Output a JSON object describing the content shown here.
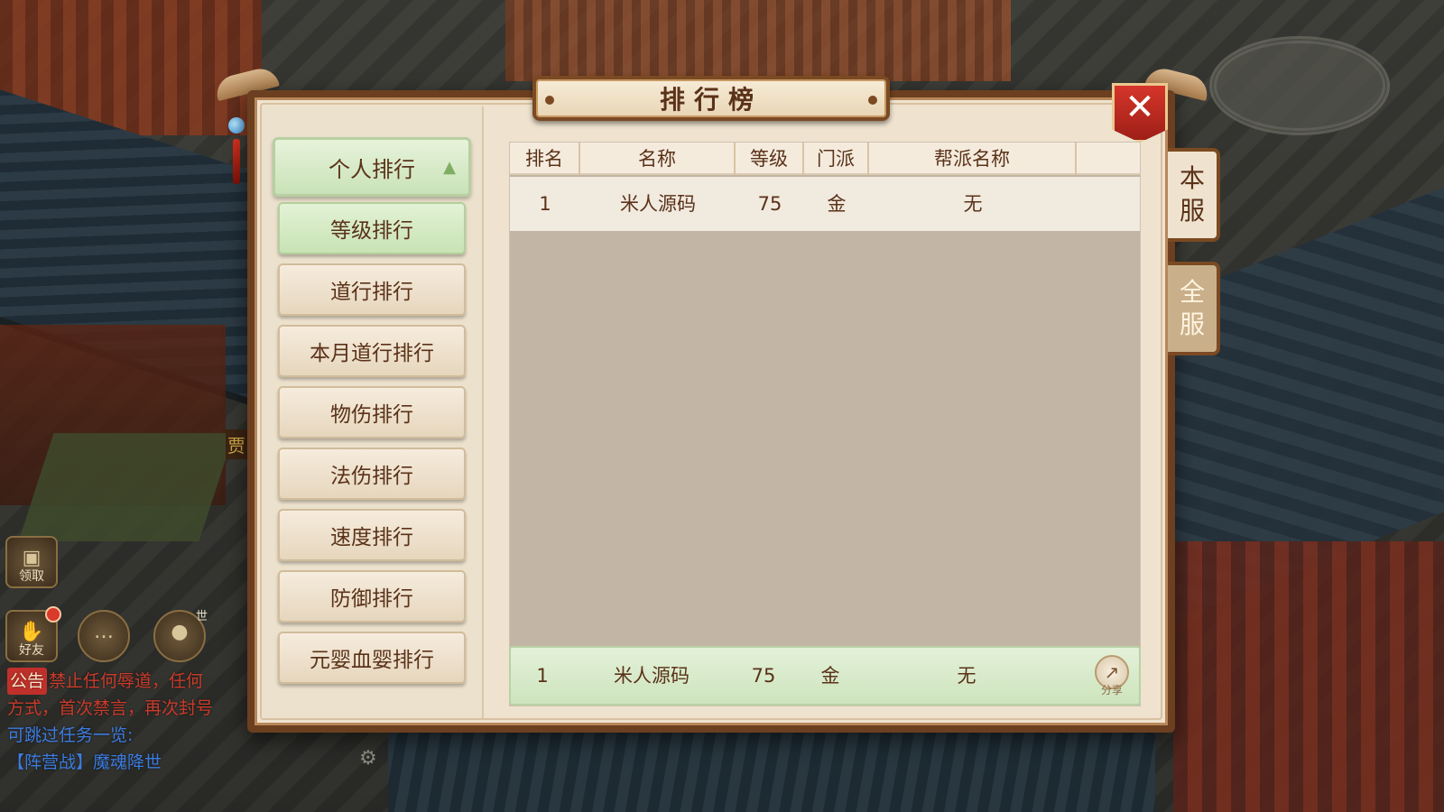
{
  "dialog": {
    "title": "排行榜",
    "close_label": "✕"
  },
  "server_tabs": [
    {
      "label_1": "本",
      "label_2": "服",
      "active": true
    },
    {
      "label_1": "全",
      "label_2": "服",
      "active": false
    }
  ],
  "category": {
    "header": "个人排行",
    "items": [
      {
        "label": "等级排行",
        "selected": true
      },
      {
        "label": "道行排行",
        "selected": false
      },
      {
        "label": "本月道行排行",
        "selected": false
      },
      {
        "label": "物伤排行",
        "selected": false
      },
      {
        "label": "法伤排行",
        "selected": false
      },
      {
        "label": "速度排行",
        "selected": false
      },
      {
        "label": "防御排行",
        "selected": false
      },
      {
        "label": "元婴血婴排行",
        "selected": false
      }
    ]
  },
  "table": {
    "columns": [
      "排名",
      "名称",
      "等级",
      "门派",
      "帮派名称"
    ],
    "rows": [
      {
        "rank": "1",
        "name": "米人源码",
        "level": "75",
        "school": "金",
        "guild": "无"
      }
    ]
  },
  "my_rank": {
    "rank": "1",
    "name": "米人源码",
    "level": "75",
    "school": "金",
    "guild": "无",
    "share_label": "分享"
  },
  "hud": {
    "claim_label": "领取",
    "friend_label": "好友",
    "mic_tag": "世",
    "left_tag": "贾"
  },
  "chat": {
    "notice_tag": "公告",
    "line1": "禁止任何辱道，任何",
    "line2": "方式，首次禁言，再次封号",
    "line3": "可跳过任务一览:",
    "line4": "【阵营战】魔魂降世"
  },
  "colors": {
    "frame": "#6b3f1f",
    "panel": "#efe3cf",
    "selected_green": "#c8e3b4",
    "close_red": "#d6352a"
  }
}
